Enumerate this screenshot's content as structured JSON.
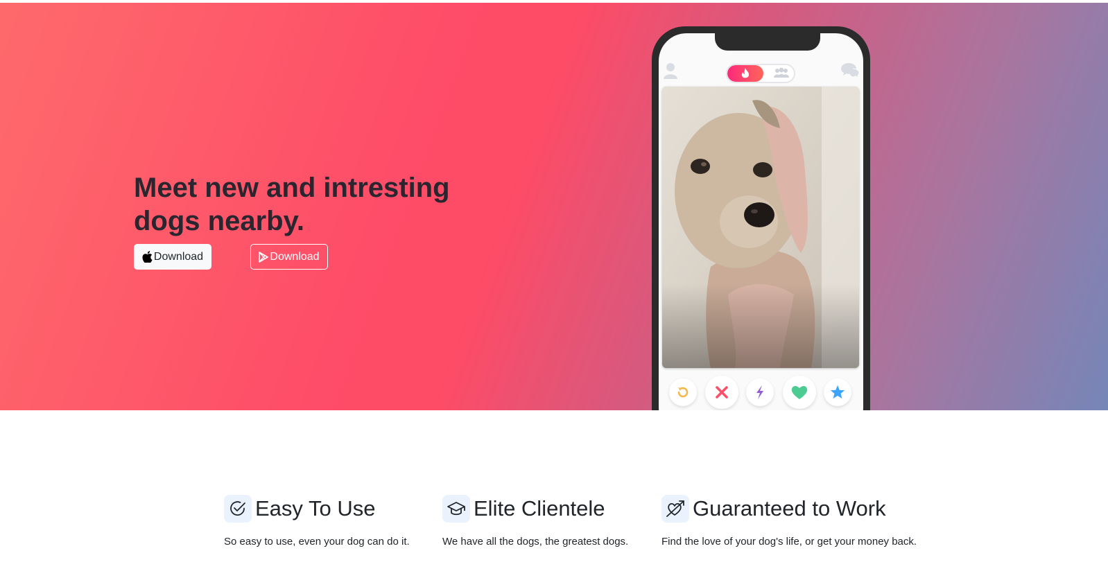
{
  "hero": {
    "title": "Meet new and intresting dogs nearby.",
    "apple_button": {
      "label": "Download",
      "icon": "apple-icon"
    },
    "play_button": {
      "label": "Download",
      "icon": "google-play-icon"
    },
    "gradient_colors": [
      "#fe6a6c",
      "#fe4d68",
      "#d65a7f",
      "#a776a0",
      "#7586b8"
    ]
  },
  "phone": {
    "top_bar": {
      "left_icon": "profile-icon",
      "toggle": [
        "flame-icon",
        "group-icon"
      ],
      "right_icon": "chat-icon"
    },
    "card_image": "dog-photo",
    "actions": [
      {
        "icon": "rewind-icon",
        "color": "#f5b748"
      },
      {
        "icon": "nope-icon",
        "color": "#fd5068"
      },
      {
        "icon": "boost-icon",
        "color": "#915dd1"
      },
      {
        "icon": "like-icon",
        "color": "#4ccc93"
      },
      {
        "icon": "super-like-icon",
        "color": "#3ca4ff"
      }
    ]
  },
  "features": [
    {
      "icon": "check-circle-icon",
      "title": "Easy To Use",
      "text": "So easy to use, even your dog can do it."
    },
    {
      "icon": "graduation-cap-icon",
      "title": "Elite Clientele",
      "text": "We have all the dogs, the greatest dogs."
    },
    {
      "icon": "heart-arrow-icon",
      "title": "Guaranteed to Work",
      "text": "Find the love of your dog's life, or get your money back."
    }
  ]
}
